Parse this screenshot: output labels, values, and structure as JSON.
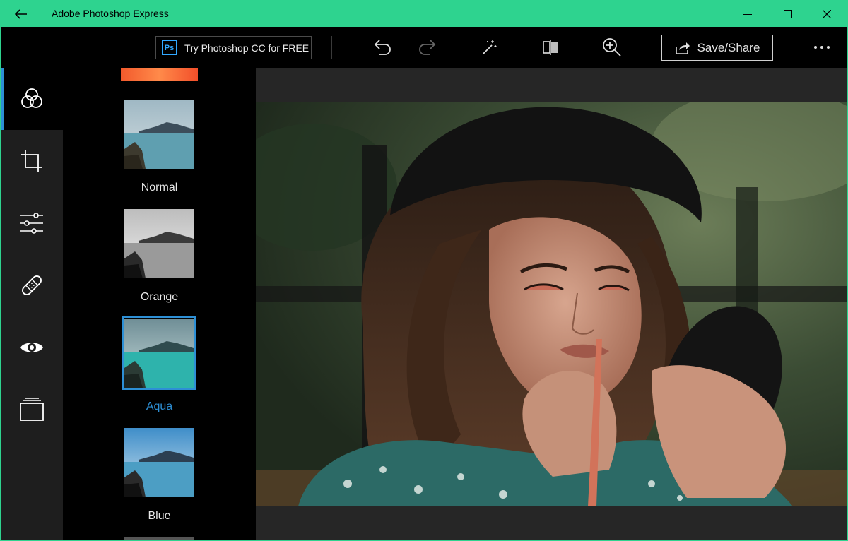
{
  "app": {
    "title": "Adobe Photoshop Express"
  },
  "titlebar": {
    "back_icon": "back-arrow-icon",
    "controls": [
      "minimize-icon",
      "maximize-icon",
      "close-icon"
    ]
  },
  "toolbar": {
    "try_label": "Try Photoshop CC for FREE",
    "ps_badge": "Ps",
    "save_label": "Save/Share",
    "icons": [
      "undo-icon",
      "redo-icon",
      "magic-wand-icon",
      "compare-icon",
      "zoom-in-icon",
      "save-share-icon",
      "more-icon"
    ]
  },
  "rail": {
    "items": [
      {
        "name": "looks",
        "icon": "looks-circles-icon",
        "active": true
      },
      {
        "name": "crop",
        "icon": "crop-icon",
        "active": false
      },
      {
        "name": "adjustments",
        "icon": "sliders-icon",
        "active": false
      },
      {
        "name": "heal",
        "icon": "bandage-icon",
        "active": false
      },
      {
        "name": "red-eye",
        "icon": "eye-icon",
        "active": false
      },
      {
        "name": "borders",
        "icon": "layers-icon",
        "active": false
      }
    ]
  },
  "filters": {
    "items": [
      {
        "label": "Normal",
        "selected": false
      },
      {
        "label": "Orange",
        "selected": false
      },
      {
        "label": "Aqua",
        "selected": true
      },
      {
        "label": "Blue",
        "selected": false
      }
    ]
  },
  "colors": {
    "accent": "#2d8fd5",
    "titlebar": "#2ed38f",
    "photoshop_blue": "#31a8ff"
  }
}
